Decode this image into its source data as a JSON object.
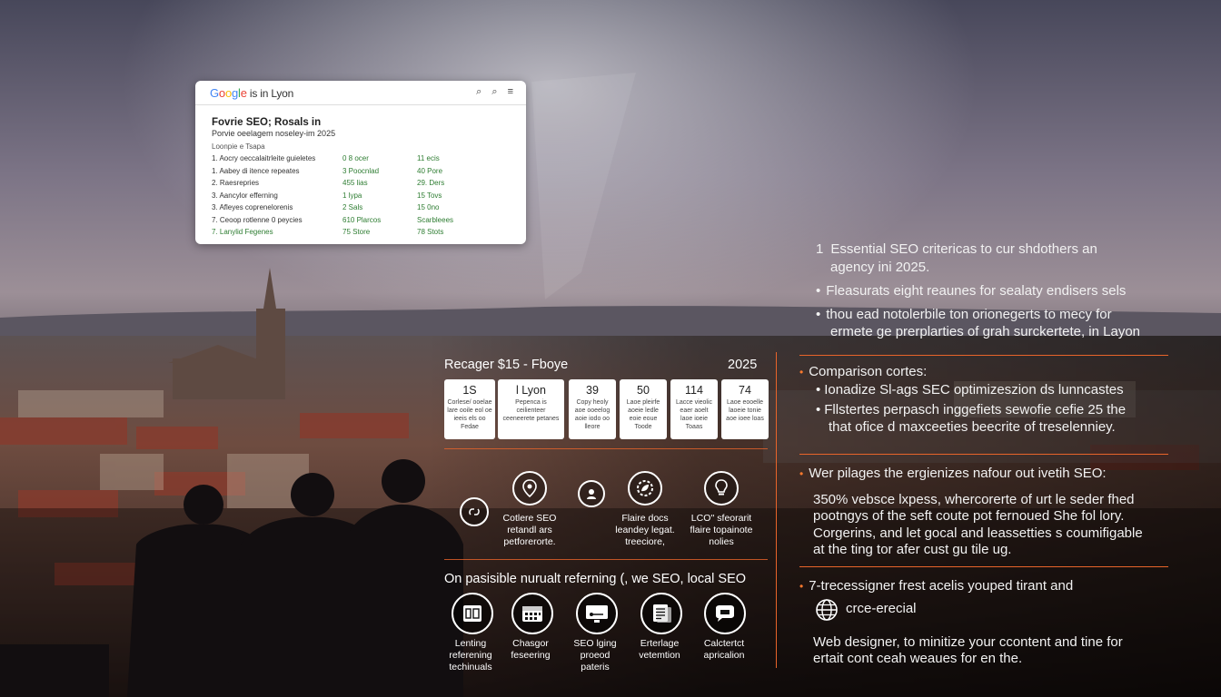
{
  "google_card": {
    "logo": [
      "G",
      "o",
      "o",
      "g",
      "l",
      "e"
    ],
    "search_text": " is in Lyon",
    "search_icon": "search-icon",
    "menu_icon": "menu-icon",
    "title": "Fovrie SEO; Rosals in",
    "subtitle": "Porvie oeelagem noseley-im 2025",
    "small": "Loonpie e Tsapa",
    "rows": [
      {
        "name": "1. Aocry oeccalaitrleite guieletes",
        "col2": "0 8 ocer",
        "col3": "11 ecis"
      },
      {
        "name": "1. Aabey di itence repeates",
        "col2": "3 Poocnlad",
        "col3": "40 Pore"
      },
      {
        "name": "2. Raesrepries",
        "col2": "455 lias",
        "col3": "29. Ders"
      },
      {
        "name": "3. Aancylor efferning",
        "col2": "1 lypa",
        "col3": "15 Tovs"
      },
      {
        "name": "3. Afleyes coprenelorenis",
        "col2": "2 Sals",
        "col3": "15 0no"
      },
      {
        "name": "7. Ceoop rotlenne 0 peycies",
        "col2": "610 Plarcos",
        "col3": "Scarbleees"
      },
      {
        "name": "7. Lanylid Fegenes",
        "col2": "75 Store",
        "col3": "78 Stots"
      }
    ]
  },
  "right_top": {
    "item1_num": "1",
    "item1_line1": "Essential SEO critericas to cur shdothers an",
    "item1_line2": "agency ini 2025.",
    "item2": "Fleasurats eight reaunes for sealaty endisers sels",
    "item3_line1": "thou ead notolerbile ton orionegerts to mecy for",
    "item3_line2": "ermete ge prerplarties of grah surckertete, in Layon"
  },
  "comparison": {
    "heading": "Comparison cortes:",
    "b1": "Ionadize Sl-ags SEC optimizeszion ds lunncastes",
    "b2_line1": "Fllstertes perpasch inggefiets sewofie cefie 25 the",
    "b2_line2": "that ofice d maxceeties beecrite of treselenniey."
  },
  "web": {
    "heading": "Wer pilages the ergienizes nafour out ivetih SEO:",
    "p1": "350% vebsce lxpess, whercorerte of urt le seder fhed",
    "p2": "pootngys of the seft coute pot fernoued She fol lory.",
    "p3": "Corgerins, and let gocal and leassetties s coumifigable",
    "p4": "at the ting tor afer cust gu tile ug."
  },
  "designer": {
    "heading": "7-trecessigner frest acelis youped tirant and",
    "globe_icon": "globe-icon",
    "globe_label": "crce-erecial",
    "p1": "Web designer, to minitize your ccontent and tine for",
    "p2": "ertait cont ceah weaues for en the."
  },
  "pricing": {
    "title": "Recager $15 - Fboye",
    "year": "2025",
    "cards": [
      {
        "value": "1S",
        "desc": "Corlese/ ooelae lare ooile eol oe ieeis els oo Fedae"
      },
      {
        "value": "l Lyon",
        "desc": "Pepenca is ceilienteer ceeneerete petanes"
      },
      {
        "value": "39",
        "desc": "Copy heoly aoe ooeelog aoie iodo oo lleore"
      },
      {
        "value": "50",
        "desc": "Laoe pleirfe aoeie ledle eoie eoue Toode"
      },
      {
        "value": "114",
        "desc": "Lacce vieolic eaer aoelt laoe ioeie Toaas"
      },
      {
        "value": "74",
        "desc": "Laoe eooelle laoeie tonie aoe ioee loas"
      }
    ]
  },
  "features": [
    {
      "icon": "location-pin-icon",
      "label1": "Cotlere SEO",
      "label2": "retandl ars",
      "label3": "petforerorte."
    },
    {
      "icon": "gear-leaf-icon",
      "label1": "Flaire docs",
      "label2": "leandey legat.",
      "label3": "treeciore,"
    },
    {
      "icon": "lightbulb-icon",
      "label1": "LCO'' sfeorarit",
      "label2": "flaire topainote",
      "label3": "nolies"
    }
  ],
  "services": {
    "heading": "On pasisible nurualt referning (, we SEO, local SEO",
    "items": [
      {
        "icon": "document-icon",
        "label1": "Lenting",
        "label2": "referening",
        "label3": "techinuals"
      },
      {
        "icon": "calendar-icon",
        "label1": "Chasgor",
        "label2": "feseering",
        "label3": ""
      },
      {
        "icon": "monitor-icon",
        "label1": "SEO lging",
        "label2": "proeod",
        "label3": "pateris"
      },
      {
        "icon": "report-icon",
        "label1": "Erterlage",
        "label2": "vetemtion",
        "label3": ""
      },
      {
        "icon": "chat-icon",
        "label1": "Calctertct",
        "label2": "apricalion",
        "label3": ""
      }
    ]
  }
}
